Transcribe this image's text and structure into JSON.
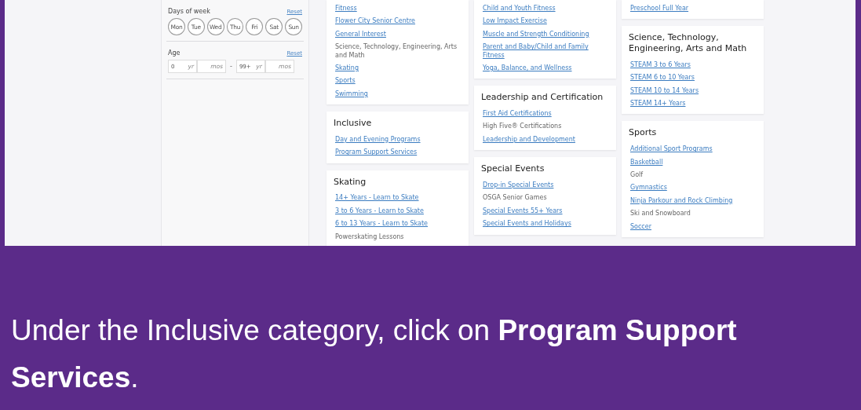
{
  "sidebar": {
    "days": {
      "label": "Days of week",
      "reset": "Reset",
      "days": [
        "Mon",
        "Tue",
        "Wed",
        "Thu",
        "Fri",
        "Sat",
        "Sun"
      ]
    },
    "age": {
      "label": "Age",
      "reset": "Reset",
      "from_years": "0",
      "from_years_unit": "yr",
      "from_months_unit": "mos",
      "separator": "-",
      "to_years": "99+",
      "to_years_unit": "yr",
      "to_months_unit": "mos"
    }
  },
  "columns": [
    [
      {
        "items": [
          {
            "kind": "link",
            "text": "Fitness"
          },
          {
            "kind": "link",
            "text": "Flower City Senior Centre"
          },
          {
            "kind": "link",
            "text": "General Interest"
          },
          {
            "kind": "text",
            "text": "Science, Technology, Engineering, Arts and Math"
          },
          {
            "kind": "link",
            "text": "Skating"
          },
          {
            "kind": "link",
            "text": "Sports"
          },
          {
            "kind": "link",
            "text": "Swimming"
          }
        ]
      },
      {
        "title": "Inclusive",
        "items": [
          {
            "kind": "link",
            "text": "Day and Evening Programs"
          },
          {
            "kind": "link",
            "text": "Program Support Services"
          }
        ]
      },
      {
        "title": "Skating",
        "items": [
          {
            "kind": "link",
            "text": "14+ Years - Learn to Skate"
          },
          {
            "kind": "link",
            "text": "3 to 6 Years - Learn to Skate"
          },
          {
            "kind": "link",
            "text": "6 to 13 Years - Learn to Skate"
          },
          {
            "kind": "text",
            "text": "Powerskating Lessons"
          }
        ]
      }
    ],
    [
      {
        "items": [
          {
            "kind": "link",
            "text": "Child and Youth Fitness"
          },
          {
            "kind": "link",
            "text": "Low Impact Exercise"
          },
          {
            "kind": "link",
            "text": "Muscle and Strength Conditioning"
          },
          {
            "kind": "link",
            "text": "Parent and Baby/Child and Family Fitness"
          },
          {
            "kind": "link",
            "text": "Yoga, Balance, and Wellness"
          }
        ]
      },
      {
        "title": "Leadership and Certification",
        "items": [
          {
            "kind": "link",
            "text": "First Aid Certifications"
          },
          {
            "kind": "text",
            "text": "High Five® Certifications"
          },
          {
            "kind": "link",
            "text": "Leadership and Development"
          }
        ]
      },
      {
        "title": "Special Events",
        "items": [
          {
            "kind": "link",
            "text": "Drop-in Special Events"
          },
          {
            "kind": "text",
            "text": "OSGA Senior Games"
          },
          {
            "kind": "link",
            "text": "Special Events 55+ Years"
          },
          {
            "kind": "link",
            "text": "Special Events and Holidays"
          }
        ]
      }
    ],
    [
      {
        "items": [
          {
            "kind": "link",
            "text": "Preschool Full Year"
          }
        ]
      },
      {
        "title": "Science, Technology, Engineering, Arts and Math",
        "items": [
          {
            "kind": "link",
            "text": "STEAM 3 to 6 Years"
          },
          {
            "kind": "link",
            "text": "STEAM 6 to 10 Years"
          },
          {
            "kind": "link",
            "text": "STEAM 10 to 14 Years"
          },
          {
            "kind": "link",
            "text": "STEAM 14+ Years"
          }
        ]
      },
      {
        "title": "Sports",
        "items": [
          {
            "kind": "link",
            "text": "Additional Sport Programs"
          },
          {
            "kind": "link",
            "text": "Basketball"
          },
          {
            "kind": "text",
            "text": "Golf"
          },
          {
            "kind": "link",
            "text": "Gymnastics"
          },
          {
            "kind": "link",
            "text": "Ninja Parkour and Rock Climbing"
          },
          {
            "kind": "text",
            "text": "Ski and Snowboard"
          },
          {
            "kind": "link",
            "text": "Soccer"
          }
        ]
      }
    ]
  ],
  "caption": "Under the Inclusive category, click on **Program Support Services**."
}
